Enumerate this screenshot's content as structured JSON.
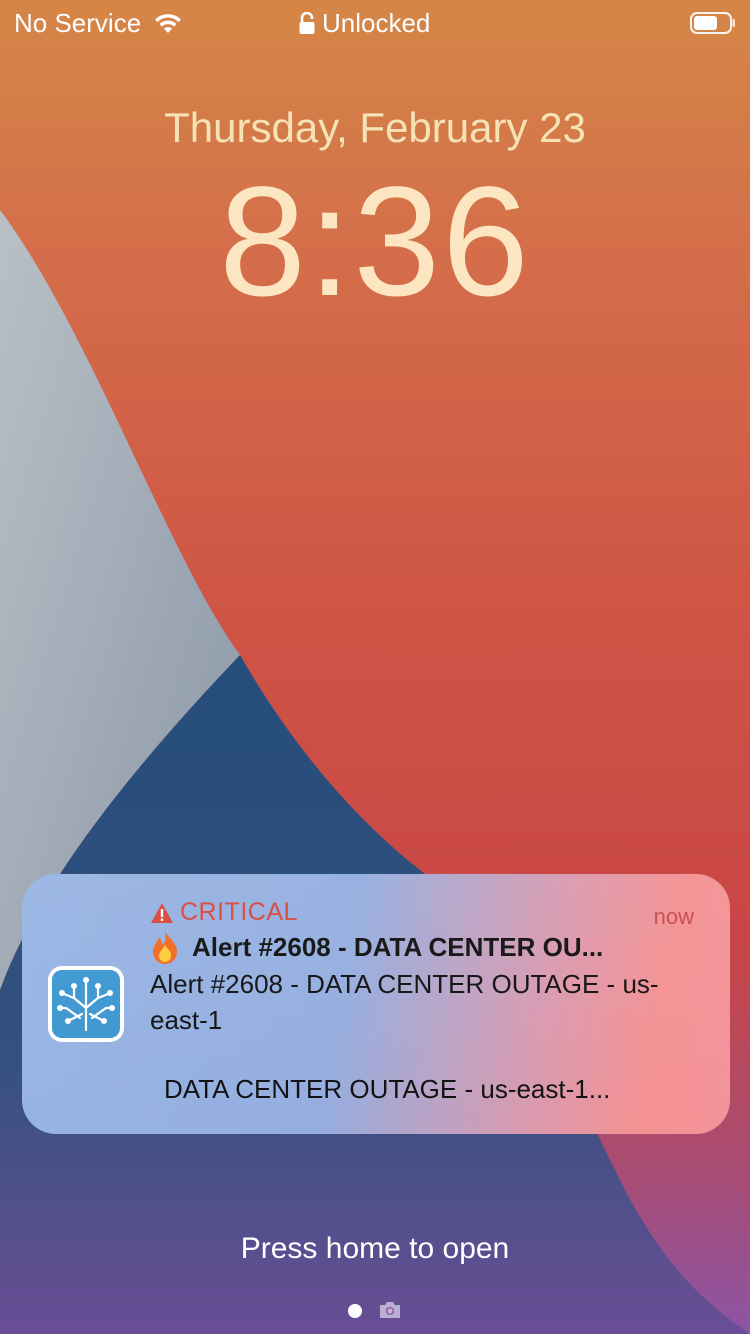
{
  "status_bar": {
    "carrier": "No Service",
    "lock_status": "Unlocked",
    "wifi_icon": "wifi-icon",
    "lock_icon": "lock-icon",
    "battery_icon": "battery-icon"
  },
  "lockscreen": {
    "date": "Thursday, February 23",
    "time": "8:36"
  },
  "notification": {
    "severity": "CRITICAL",
    "timestamp": "now",
    "title": "Alert #2608 - DATA CENTER OU...",
    "body": "Alert #2608 - DATA CENTER OUTAGE - us-east-1",
    "summary": "DATA CENTER OUTAGE - us-east-1...",
    "severity_color": "#d9473b",
    "app_icon": "circuit-tree-app-icon"
  },
  "footer": {
    "press_home": "Press home to open",
    "camera_icon": "camera-icon"
  }
}
